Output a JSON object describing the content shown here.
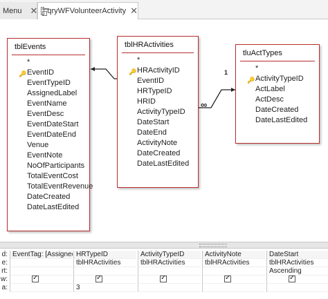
{
  "tabs": {
    "menu_label": "Menu",
    "close_glyph": "✕",
    "query_label": "qryWFVolunteerActivity"
  },
  "tables": {
    "tblEvents": {
      "title": "tblEvents",
      "fields": [
        "*",
        "EventID",
        "EventTypeID",
        "AssignedLabel",
        "EventName",
        "EventDesc",
        "EventDateStart",
        "EventDateEnd",
        "Venue",
        "EventNote",
        "NoOfParticipants",
        "TotalEventCost",
        "TotalEventRevenue",
        "DateCreated",
        "DateLastEdited"
      ]
    },
    "tblHRActivities": {
      "title": "tblHRActivities",
      "fields": [
        "*",
        "HRActivityID",
        "EventID",
        "HRTypeID",
        "HRID",
        "ActivityTypeID",
        "DateStart",
        "DateEnd",
        "ActivityNote",
        "DateCreated",
        "DateLastEdited"
      ]
    },
    "tluActTypes": {
      "title": "tluActTypes",
      "fields": [
        "*",
        "ActivityTypeID",
        "ActLabel",
        "ActDesc",
        "DateCreated",
        "DateLastEdited"
      ]
    }
  },
  "relationships": {
    "one_label": "1",
    "many_label": "∞"
  },
  "grid": {
    "row_labels": [
      "d:",
      "e:",
      "rt:",
      "w:",
      "a:"
    ],
    "columns": [
      {
        "field": "EventTag: [AssignedLa",
        "table": "",
        "sort": "",
        "show": false,
        "criteria": ""
      },
      {
        "field": "HRTypeID",
        "table": "tblHRActivities",
        "sort": "",
        "show": true,
        "criteria": "3"
      },
      {
        "field": "ActivityTypeID",
        "table": "tblHRActivities",
        "sort": "",
        "show": true,
        "criteria": ""
      },
      {
        "field": "ActivityNote",
        "table": "tblHRActivities",
        "sort": "",
        "show": true,
        "criteria": ""
      },
      {
        "field": "DateStart",
        "table": "tblHRActivities",
        "sort": "Ascending",
        "show": true,
        "criteria": ""
      }
    ],
    "show_checked": [
      true,
      true,
      true,
      true,
      true
    ]
  }
}
